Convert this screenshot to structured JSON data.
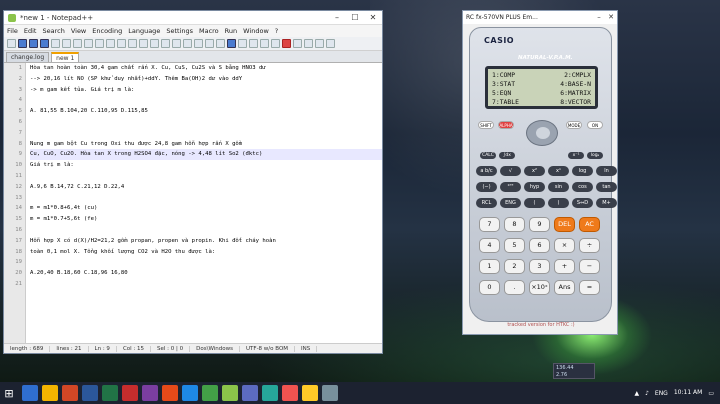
{
  "npp": {
    "title": "*new 1 - Notepad++",
    "menu": [
      "File",
      "Edit",
      "Search",
      "View",
      "Encoding",
      "Language",
      "Settings",
      "Macro",
      "Run",
      "Window",
      "?"
    ],
    "tabs": [
      "change.log",
      "new 1"
    ],
    "line_numbers": [
      "1",
      "2",
      "3",
      "4",
      "5",
      "6",
      "7",
      "8",
      "9",
      "10",
      "11",
      "12",
      "13",
      "14",
      "15",
      "16",
      "17",
      "18",
      "19",
      "20",
      "21"
    ],
    "lines": [
      "Hòa tan hoàn toàn 30,4 gam chất rắn X. Cu, CuS, Cu2S và S bằng HNO3 dư",
      "--> 20,16 lít NO (SP khử duy nhất)+ddY. Thêm Ba(OH)2 dư vào ddY",
      "-> m gam kết tủa. Giá trị m là:",
      "",
      "A. 81,55 B.104,20 C.110,95 D.115,85",
      "",
      "",
      "Nung m gam bột Cu trong Oxi thu được 24,8 gam hỗn hợp rắn X gồm",
      "Cu, CuO, Cu2O. Hòa tan X trong H2SO4 đặc, nóng -> 4,48 lít So2 (đktc)",
      "Giá trị m là:",
      "",
      "A.9,6 B.14,72 C.21,12 D.22,4",
      "",
      "m = m1*0.8+6,4t (cu)",
      "m = m1*0.7+5,6t (fe)",
      "",
      "Hỗn hợp X có d(X)/H2=21,2 gồm propan, propen và propin. Khi đốt cháy hoàn",
      "toàn 0,1 mol X. Tổng khối lượng CO2 và H2O thu được là:",
      "",
      "A.20,40 B.18,60 C.18,96 16,80",
      ""
    ],
    "status": [
      "length : 689",
      "lines : 21",
      "Ln : 9",
      "Col : 15",
      "Sel : 0 | 0",
      "Dos\\Windows",
      "UTF-8 w/o BOM",
      "INS"
    ]
  },
  "calc": {
    "title": "RC fx-570VN PLUS Em...",
    "brand": "CASIO",
    "series": "NATURAL-V.P.A.M.",
    "menu": [
      [
        "1:COMP",
        "2:CMPLX"
      ],
      [
        "3:STAT",
        "4:BASE-N"
      ],
      [
        "5:EQN",
        "6:MATRIX"
      ],
      [
        "7:TABLE",
        "8:VECTOR"
      ]
    ],
    "fkeys": [
      "SHIFT",
      "ALPHA",
      "MODE",
      "ON"
    ],
    "row1": [
      "CALC",
      "∫dx",
      "x⁻¹",
      "logₐ"
    ],
    "row2": [
      "a b/c",
      "√",
      "x²",
      "xⁿ",
      "log",
      "ln"
    ],
    "row3": [
      "(−)",
      "°'\"",
      "hyp",
      "sin",
      "cos",
      "tan"
    ],
    "row4": [
      "RCL",
      "ENG",
      "(",
      ")",
      "S⇔D",
      "M+"
    ],
    "digits": [
      [
        "7",
        "8",
        "9",
        "DEL",
        "AC"
      ],
      [
        "4",
        "5",
        "6",
        "×",
        "÷"
      ],
      [
        "1",
        "2",
        "3",
        "+",
        "−"
      ],
      [
        "0",
        ".",
        "×10ˣ",
        "Ans",
        "="
      ]
    ],
    "tracked": "tracked version for HTKC :)"
  },
  "taskbar": {
    "time": "10:11 AM",
    "lang": "ENG",
    "mini": [
      "136.44",
      "2.76"
    ]
  }
}
